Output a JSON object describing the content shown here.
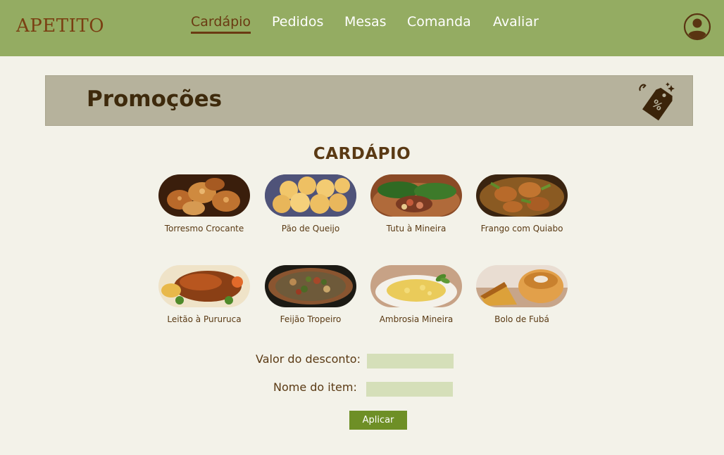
{
  "header": {
    "brand": "APETITO",
    "nav": [
      {
        "label": "Cardápio",
        "active": true
      },
      {
        "label": "Pedidos",
        "active": false
      },
      {
        "label": "Mesas",
        "active": false
      },
      {
        "label": "Comanda",
        "active": false
      },
      {
        "label": "Avaliar",
        "active": false
      }
    ],
    "profile_icon": "user-circle-icon"
  },
  "banner": {
    "title": "Promoções",
    "icon": "discount-tag-icon"
  },
  "menu": {
    "heading": "CARDÁPIO",
    "items": [
      {
        "label": "Torresmo Crocante",
        "image": "torresmo-photo"
      },
      {
        "label": "Pão de Queijo",
        "image": "pao-de-queijo-photo"
      },
      {
        "label": "Tutu à Mineira",
        "image": "tutu-photo"
      },
      {
        "label": "Frango com Quiabo",
        "image": "frango-photo"
      },
      {
        "label": "Leitão à Pururuca",
        "image": "leitao-photo"
      },
      {
        "label": "Feijão Tropeiro",
        "image": "feijao-photo"
      },
      {
        "label": "Ambrosia Mineira",
        "image": "ambrosia-photo"
      },
      {
        "label": "Bolo de Fubá",
        "image": "bolo-photo"
      }
    ]
  },
  "form": {
    "discount_label": "Valor do desconto:",
    "discount_value": "",
    "item_label": "Nome do item:",
    "item_value": "",
    "apply_label": "Aplicar"
  },
  "colors": {
    "header_bg": "#94ac62",
    "page_bg": "#f3f2e9",
    "banner_bg": "#b6b29c",
    "input_bg": "#d5dfb9",
    "button_bg": "#6e8f26",
    "text_brown": "#5a3a14"
  }
}
